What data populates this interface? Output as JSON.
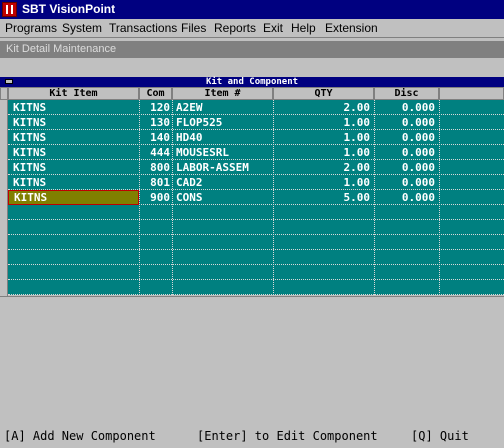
{
  "window": {
    "title": "SBT VisionPoint"
  },
  "menu": [
    {
      "label": "Programs"
    },
    {
      "label": "System"
    },
    {
      "label": "Transactions"
    },
    {
      "label": "Files"
    },
    {
      "label": "Reports"
    },
    {
      "label": "Exit"
    },
    {
      "label": "Help"
    },
    {
      "label": "Extension"
    }
  ],
  "form": {
    "title": "Kit Detail Maintenance"
  },
  "grid": {
    "caption": "Kit and Component",
    "columns": [
      "Kit Item",
      "Com",
      "Item #",
      "QTY",
      "Disc"
    ],
    "rows": [
      {
        "kit": "KITNS",
        "comp": "120",
        "item": "A2EW",
        "qty": "2.00",
        "disc": "0.000"
      },
      {
        "kit": "KITNS",
        "comp": "130",
        "item": "FLOP525",
        "qty": "1.00",
        "disc": "0.000"
      },
      {
        "kit": "KITNS",
        "comp": "140",
        "item": "HD40",
        "qty": "1.00",
        "disc": "0.000"
      },
      {
        "kit": "KITNS",
        "comp": "444",
        "item": "MOUSESRL",
        "qty": "1.00",
        "disc": "0.000"
      },
      {
        "kit": "KITNS",
        "comp": "800",
        "item": "LABOR-ASSEM",
        "qty": "2.00",
        "disc": "0.000"
      },
      {
        "kit": "KITNS",
        "comp": "801",
        "item": "CAD2",
        "qty": "1.00",
        "disc": "0.000"
      },
      {
        "kit": "KITNS",
        "comp": "900",
        "item": "CONS",
        "qty": "5.00",
        "disc": "0.000"
      }
    ],
    "selected_row": 6,
    "colors": {
      "background": "#008080",
      "selection": "#808000",
      "selection_border": "#c00000"
    }
  },
  "status": {
    "add": "[A] Add New Component",
    "edit": "[Enter] to Edit Component",
    "quit": "[Q] Quit"
  }
}
